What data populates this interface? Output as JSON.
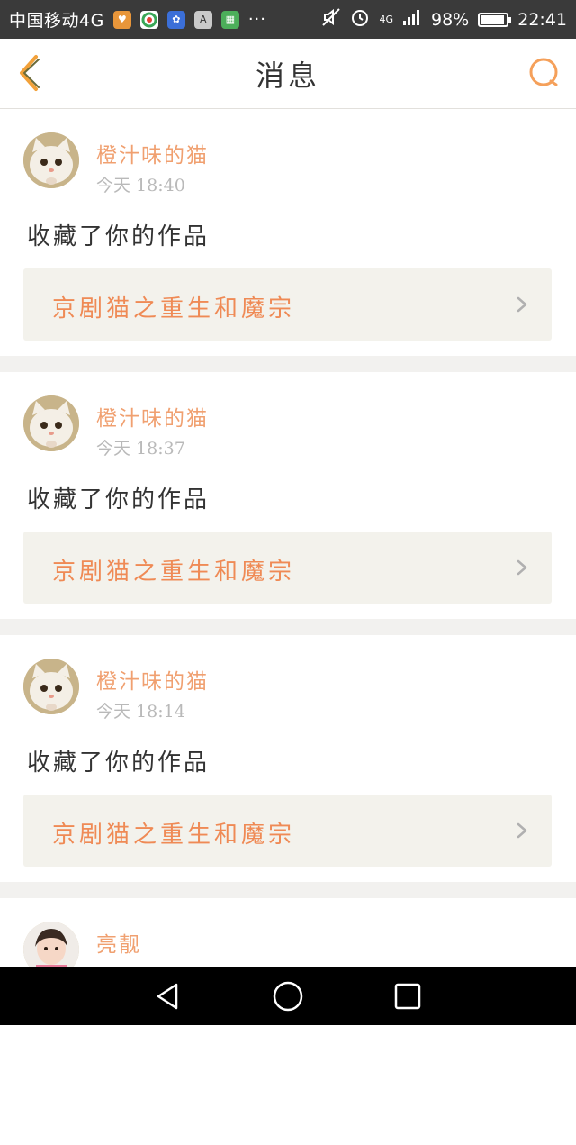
{
  "status_bar": {
    "carrier": "中国移动4G",
    "network": "4G",
    "battery": "98%",
    "battery_level": 0.98,
    "time": "22:41",
    "icons": [
      "app-icon-orange",
      "app-icon-browser",
      "app-icon-paw",
      "app-icon-a",
      "app-icon-green",
      "more-dots-icon",
      "mute-icon",
      "alarm-icon",
      "signal-icon",
      "battery-icon"
    ],
    "more": "···"
  },
  "header": {
    "title": "消息",
    "back_icon": "chevron-left-icon",
    "search_icon": "search-icon"
  },
  "messages": [
    {
      "user": "橙汁味的猫",
      "time": "今天 18:40",
      "action": "收藏了你的作品",
      "work": "京剧猫之重生和魔宗",
      "avatar": "cat"
    },
    {
      "user": "橙汁味的猫",
      "time": "今天 18:37",
      "action": "收藏了你的作品",
      "work": "京剧猫之重生和魔宗",
      "avatar": "cat"
    },
    {
      "user": "橙汁味的猫",
      "time": "今天 18:14",
      "action": "收藏了你的作品",
      "work": "京剧猫之重生和魔宗",
      "avatar": "cat"
    },
    {
      "user": "亮靓",
      "time": "",
      "action": "",
      "work": "",
      "avatar": "child"
    }
  ],
  "colors": {
    "accent": "#ef8a55",
    "username": "#f0a070",
    "background": "#f2f1ef",
    "status_bar": "#3a3a3a",
    "nav_bar": "#000000"
  },
  "nav_bar": {
    "icons": [
      "back-triangle-icon",
      "home-circle-icon",
      "recents-square-icon"
    ]
  }
}
